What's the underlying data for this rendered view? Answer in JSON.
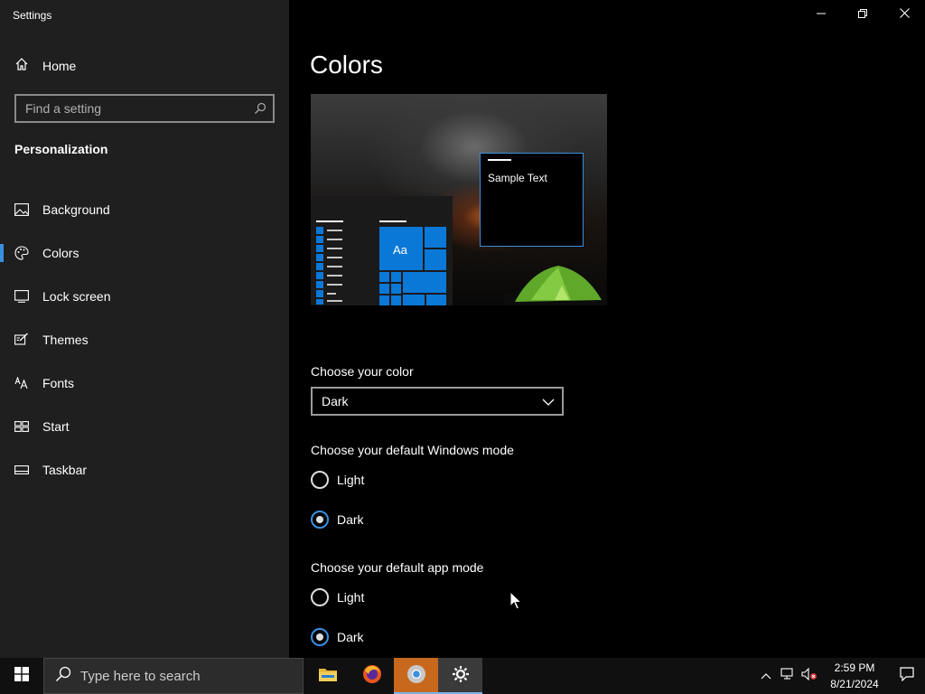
{
  "window": {
    "title": "Settings",
    "minimize_icon": "minimize-icon",
    "restore_icon": "restore-icon",
    "close_icon": "close-icon"
  },
  "sidebar": {
    "home_label": "Home",
    "search_placeholder": "Find a setting",
    "section_title": "Personalization",
    "items": [
      {
        "label": "Background",
        "icon": "image-icon",
        "active": false
      },
      {
        "label": "Colors",
        "icon": "palette-icon",
        "active": true
      },
      {
        "label": "Lock screen",
        "icon": "lock-screen-icon",
        "active": false
      },
      {
        "label": "Themes",
        "icon": "themes-icon",
        "active": false
      },
      {
        "label": "Fonts",
        "icon": "fonts-icon",
        "active": false
      },
      {
        "label": "Start",
        "icon": "start-icon",
        "active": false
      },
      {
        "label": "Taskbar",
        "icon": "taskbar-icon",
        "active": false
      }
    ],
    "accent_color": "#3a8fe0"
  },
  "main": {
    "title": "Colors",
    "preview": {
      "sample_text": "Sample Text",
      "tile_text": "Aa",
      "accent_color": "#0a78d7"
    },
    "choose_color": {
      "label": "Choose your color",
      "selected": "Dark"
    },
    "windows_mode": {
      "label": "Choose your default Windows mode",
      "options": [
        "Light",
        "Dark"
      ],
      "selected": "Dark"
    },
    "app_mode": {
      "label": "Choose your default app mode",
      "options": [
        "Light",
        "Dark"
      ],
      "selected": "Dark"
    }
  },
  "taskbar": {
    "search_placeholder": "Type here to search",
    "apps": [
      "File Explorer",
      "Firefox",
      "Chrome",
      "Settings"
    ],
    "clock_time": "2:59 PM",
    "clock_date": "8/21/2024"
  }
}
